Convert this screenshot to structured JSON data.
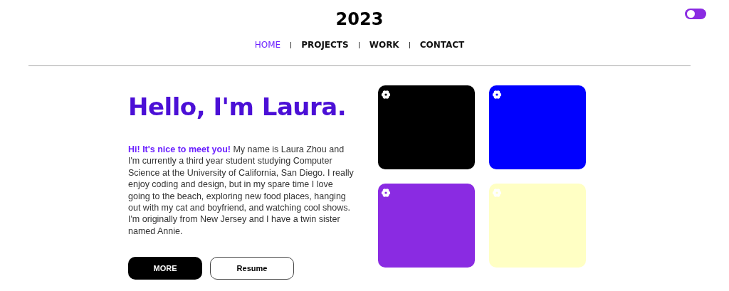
{
  "header": {
    "title": "2023",
    "theme_toggle": {
      "on": false
    }
  },
  "nav": [
    {
      "label": "HOME",
      "selected": true
    },
    {
      "label": "PROJECTS",
      "selected": false
    },
    {
      "label": "WORK",
      "selected": false
    },
    {
      "label": "CONTACT",
      "selected": false
    }
  ],
  "hero": {
    "heading": "Hello, I'm Laura.",
    "intro": "**Hi! It's nice to meet you!** My name is Laura Zhou and I'm currently a third year student studying Computer Science at the University of California, San Diego. I really enjoy coding and design, but in my spare time I love going to the beach, exploring new food places, hanging out with my cat and boyfriend, and watching cool shows. I'm originally from New Jersey and I have a twin sister named Annie.",
    "buttons": [
      {
        "label": "MORE",
        "kind": "primary"
      },
      {
        "label": "Resume",
        "kind": "outline"
      }
    ]
  },
  "swatches": [
    {
      "color": "#000000"
    },
    {
      "color": "#0000ff"
    },
    {
      "color": "#8a2be2"
    },
    {
      "color": "#ffffc4"
    }
  ]
}
